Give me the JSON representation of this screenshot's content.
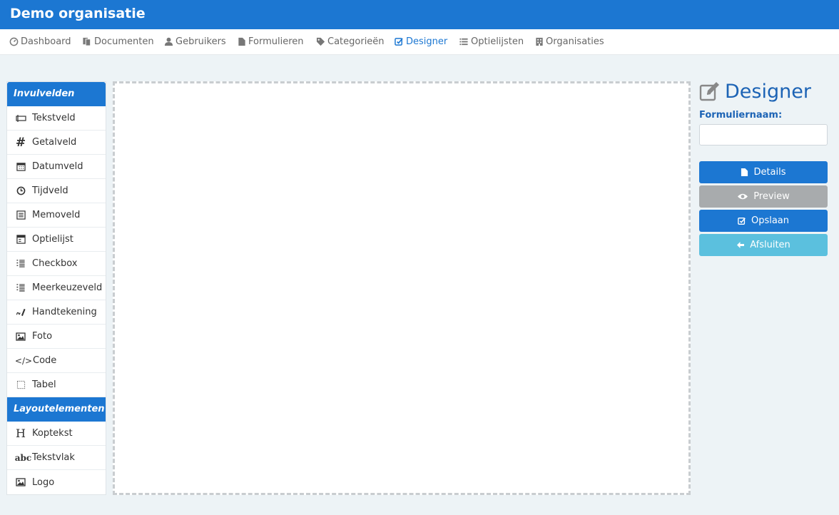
{
  "app": {
    "title": "Demo organisatie"
  },
  "nav": {
    "items": [
      {
        "label": "Dashboard",
        "icon": "dashboard-icon",
        "active": false
      },
      {
        "label": "Documenten",
        "icon": "documents-icon",
        "active": false
      },
      {
        "label": "Gebruikers",
        "icon": "user-icon",
        "active": false
      },
      {
        "label": "Formulieren",
        "icon": "file-icon",
        "active": false
      },
      {
        "label": "Categorieën",
        "icon": "tag-icon",
        "active": false
      },
      {
        "label": "Designer",
        "icon": "edit-icon",
        "active": true
      },
      {
        "label": "Optielijsten",
        "icon": "list-icon",
        "active": false
      },
      {
        "label": "Organisaties",
        "icon": "building-icon",
        "active": false
      }
    ]
  },
  "toolbox": {
    "input_header": "Invulvelden",
    "input_items": [
      {
        "label": "Tekstveld",
        "icon": "textfield-icon"
      },
      {
        "label": "Getalveld",
        "icon": "hash-icon"
      },
      {
        "label": "Datumveld",
        "icon": "calendar-icon"
      },
      {
        "label": "Tijdveld",
        "icon": "clock-icon"
      },
      {
        "label": "Memoveld",
        "icon": "memo-icon"
      },
      {
        "label": "Optielijst",
        "icon": "select-icon"
      },
      {
        "label": "Checkbox",
        "icon": "checklist-icon"
      },
      {
        "label": "Meerkeuzeveld",
        "icon": "multichoice-icon"
      },
      {
        "label": "Handtekening",
        "icon": "signature-icon"
      },
      {
        "label": "Foto",
        "icon": "image-icon"
      },
      {
        "label": "Code",
        "icon": "code-icon"
      },
      {
        "label": "Tabel",
        "icon": "table-icon"
      }
    ],
    "layout_header": "Layoutelementen",
    "layout_items": [
      {
        "label": "Koptekst",
        "icon": "heading-icon"
      },
      {
        "label": "Tekstvlak",
        "icon": "textblock-icon"
      },
      {
        "label": "Logo",
        "icon": "image-icon"
      }
    ]
  },
  "designer": {
    "title": "Designer",
    "form_name_label": "Formuliernaam:",
    "form_name_value": "",
    "buttons": {
      "details": "Details",
      "preview": "Preview",
      "save": "Opslaan",
      "close": "Afsluiten"
    }
  },
  "colors": {
    "primary": "#1c77d2",
    "heading_blue": "#1c63b5",
    "disabled_grey": "#a8abad",
    "info": "#5bc0de",
    "background": "#edf3f6"
  }
}
